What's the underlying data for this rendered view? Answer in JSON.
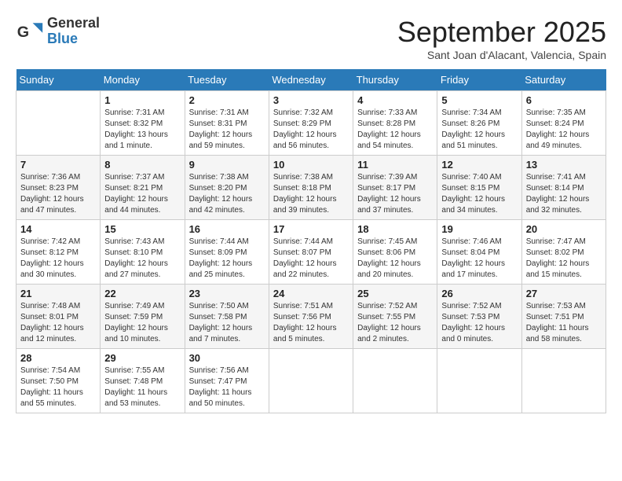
{
  "header": {
    "logo_general": "General",
    "logo_blue": "Blue",
    "month_title": "September 2025",
    "location": "Sant Joan d'Alacant, Valencia, Spain"
  },
  "days_of_week": [
    "Sunday",
    "Monday",
    "Tuesday",
    "Wednesday",
    "Thursday",
    "Friday",
    "Saturday"
  ],
  "weeks": [
    [
      {
        "num": "",
        "info": ""
      },
      {
        "num": "1",
        "info": "Sunrise: 7:31 AM\nSunset: 8:32 PM\nDaylight: 13 hours\nand 1 minute."
      },
      {
        "num": "2",
        "info": "Sunrise: 7:31 AM\nSunset: 8:31 PM\nDaylight: 12 hours\nand 59 minutes."
      },
      {
        "num": "3",
        "info": "Sunrise: 7:32 AM\nSunset: 8:29 PM\nDaylight: 12 hours\nand 56 minutes."
      },
      {
        "num": "4",
        "info": "Sunrise: 7:33 AM\nSunset: 8:28 PM\nDaylight: 12 hours\nand 54 minutes."
      },
      {
        "num": "5",
        "info": "Sunrise: 7:34 AM\nSunset: 8:26 PM\nDaylight: 12 hours\nand 51 minutes."
      },
      {
        "num": "6",
        "info": "Sunrise: 7:35 AM\nSunset: 8:24 PM\nDaylight: 12 hours\nand 49 minutes."
      }
    ],
    [
      {
        "num": "7",
        "info": "Sunrise: 7:36 AM\nSunset: 8:23 PM\nDaylight: 12 hours\nand 47 minutes."
      },
      {
        "num": "8",
        "info": "Sunrise: 7:37 AM\nSunset: 8:21 PM\nDaylight: 12 hours\nand 44 minutes."
      },
      {
        "num": "9",
        "info": "Sunrise: 7:38 AM\nSunset: 8:20 PM\nDaylight: 12 hours\nand 42 minutes."
      },
      {
        "num": "10",
        "info": "Sunrise: 7:38 AM\nSunset: 8:18 PM\nDaylight: 12 hours\nand 39 minutes."
      },
      {
        "num": "11",
        "info": "Sunrise: 7:39 AM\nSunset: 8:17 PM\nDaylight: 12 hours\nand 37 minutes."
      },
      {
        "num": "12",
        "info": "Sunrise: 7:40 AM\nSunset: 8:15 PM\nDaylight: 12 hours\nand 34 minutes."
      },
      {
        "num": "13",
        "info": "Sunrise: 7:41 AM\nSunset: 8:14 PM\nDaylight: 12 hours\nand 32 minutes."
      }
    ],
    [
      {
        "num": "14",
        "info": "Sunrise: 7:42 AM\nSunset: 8:12 PM\nDaylight: 12 hours\nand 30 minutes."
      },
      {
        "num": "15",
        "info": "Sunrise: 7:43 AM\nSunset: 8:10 PM\nDaylight: 12 hours\nand 27 minutes."
      },
      {
        "num": "16",
        "info": "Sunrise: 7:44 AM\nSunset: 8:09 PM\nDaylight: 12 hours\nand 25 minutes."
      },
      {
        "num": "17",
        "info": "Sunrise: 7:44 AM\nSunset: 8:07 PM\nDaylight: 12 hours\nand 22 minutes."
      },
      {
        "num": "18",
        "info": "Sunrise: 7:45 AM\nSunset: 8:06 PM\nDaylight: 12 hours\nand 20 minutes."
      },
      {
        "num": "19",
        "info": "Sunrise: 7:46 AM\nSunset: 8:04 PM\nDaylight: 12 hours\nand 17 minutes."
      },
      {
        "num": "20",
        "info": "Sunrise: 7:47 AM\nSunset: 8:02 PM\nDaylight: 12 hours\nand 15 minutes."
      }
    ],
    [
      {
        "num": "21",
        "info": "Sunrise: 7:48 AM\nSunset: 8:01 PM\nDaylight: 12 hours\nand 12 minutes."
      },
      {
        "num": "22",
        "info": "Sunrise: 7:49 AM\nSunset: 7:59 PM\nDaylight: 12 hours\nand 10 minutes."
      },
      {
        "num": "23",
        "info": "Sunrise: 7:50 AM\nSunset: 7:58 PM\nDaylight: 12 hours\nand 7 minutes."
      },
      {
        "num": "24",
        "info": "Sunrise: 7:51 AM\nSunset: 7:56 PM\nDaylight: 12 hours\nand 5 minutes."
      },
      {
        "num": "25",
        "info": "Sunrise: 7:52 AM\nSunset: 7:55 PM\nDaylight: 12 hours\nand 2 minutes."
      },
      {
        "num": "26",
        "info": "Sunrise: 7:52 AM\nSunset: 7:53 PM\nDaylight: 12 hours\nand 0 minutes."
      },
      {
        "num": "27",
        "info": "Sunrise: 7:53 AM\nSunset: 7:51 PM\nDaylight: 11 hours\nand 58 minutes."
      }
    ],
    [
      {
        "num": "28",
        "info": "Sunrise: 7:54 AM\nSunset: 7:50 PM\nDaylight: 11 hours\nand 55 minutes."
      },
      {
        "num": "29",
        "info": "Sunrise: 7:55 AM\nSunset: 7:48 PM\nDaylight: 11 hours\nand 53 minutes."
      },
      {
        "num": "30",
        "info": "Sunrise: 7:56 AM\nSunset: 7:47 PM\nDaylight: 11 hours\nand 50 minutes."
      },
      {
        "num": "",
        "info": ""
      },
      {
        "num": "",
        "info": ""
      },
      {
        "num": "",
        "info": ""
      },
      {
        "num": "",
        "info": ""
      }
    ]
  ]
}
